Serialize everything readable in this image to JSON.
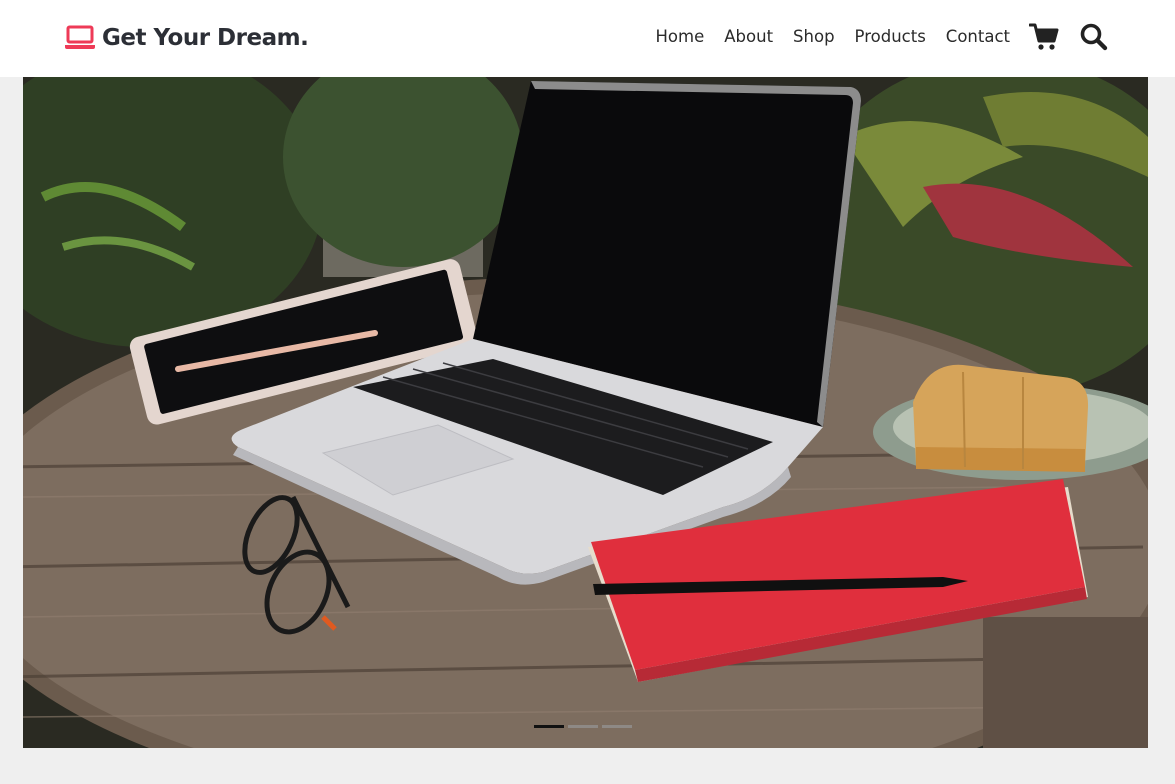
{
  "brand": {
    "name": "Get Your Dream.",
    "icon": "laptop-icon",
    "accent_color": "#ee3a57"
  },
  "nav": {
    "links": [
      {
        "label": "Home"
      },
      {
        "label": "About"
      },
      {
        "label": "Shop"
      },
      {
        "label": "Products"
      },
      {
        "label": "Contact"
      }
    ],
    "icons": [
      "cart-icon",
      "search-icon"
    ]
  },
  "hero": {
    "image": "laptop-tablet-notebook-on-wooden-table",
    "slides": 3,
    "active_slide": 1
  }
}
